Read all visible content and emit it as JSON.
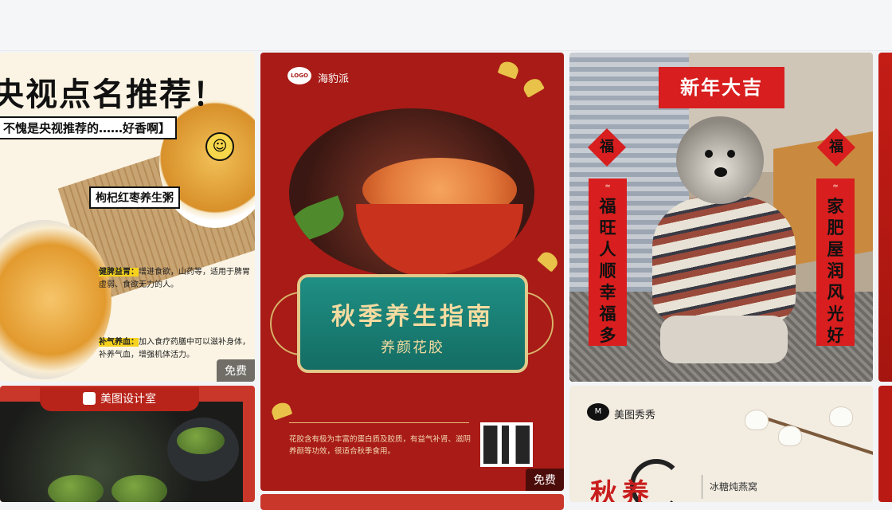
{
  "cards": {
    "c1": {
      "headline": "央视点名推荐！",
      "subline": "不愧是央视推荐的……好香啊】",
      "tag": "枸杞红枣养生粥",
      "bullet1_title": "健脾益胃：",
      "bullet1_text": "增进食欲，山药等，适用于脾胃虚弱、食欲无力的人。",
      "bullet2_title": "补气养血：",
      "bullet2_text": "加入食疗药膳中可以滋补身体，补养气血，增强机体活力。",
      "badge": "免费"
    },
    "c2": {
      "logo": "LOGO",
      "brand": "海豹派",
      "title": "秋季养生指南",
      "subtitle": "养颜花胶",
      "description": "花胶含有极为丰富的蛋白质及胶质，有益气补肾、滋阴养颜等功效，很适合秋季食用。",
      "badge": "免费"
    },
    "c3": {
      "banner": "新年大吉",
      "fu_left": "福",
      "fu_right": "福",
      "couplet_left": "福旺人顺幸福多",
      "couplet_right": "家肥屋润风光好"
    },
    "c4": {
      "brand": "美图设计室"
    },
    "c5": {
      "brand": "美图秀秀",
      "big_text": "秋养",
      "sub_text": "冰糖炖燕窝"
    }
  },
  "colors": {
    "accent_red": "#a81b16",
    "teal_banner": "#1f8f84",
    "gold": "#f4dba0"
  }
}
